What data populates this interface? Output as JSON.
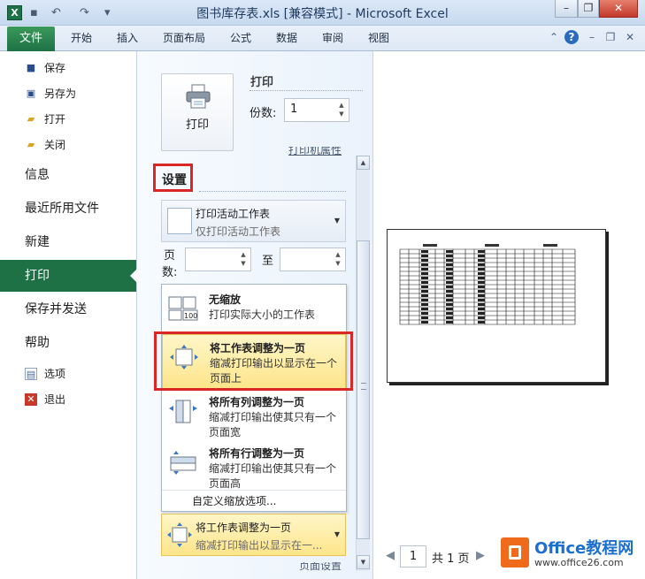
{
  "window": {
    "title": "图书库存表.xls  [兼容模式] - Microsoft Excel",
    "app_icon": "X"
  },
  "ribbon": {
    "file_tab": "文件",
    "tabs": [
      "开始",
      "插入",
      "页面布局",
      "公式",
      "数据",
      "审阅",
      "视图"
    ]
  },
  "nav": {
    "save": "保存",
    "save_as": "另存为",
    "open": "打开",
    "close": "关闭",
    "info": "信息",
    "recent": "最近所用文件",
    "new": "新建",
    "print": "打印",
    "save_send": "保存并发送",
    "help": "帮助",
    "options": "选项",
    "exit": "退出"
  },
  "print_panel": {
    "print_button": "打印",
    "header": "打印",
    "copies_label": "份数:",
    "copies_value": "1",
    "printer_properties": "打印机属性",
    "settings_header": "设置",
    "print_what": {
      "title": "打印活动工作表",
      "subtitle": "仅打印活动工作表"
    },
    "pages_label_1": "页",
    "pages_label_2": "数:",
    "to_label": "至",
    "scaling_menu": [
      {
        "title": "无缩放",
        "desc": "打印实际大小的工作表",
        "selected": false
      },
      {
        "title": "将工作表调整为一页",
        "desc": "缩减打印输出以显示在一个页面上",
        "selected": true
      },
      {
        "title": "将所有列调整为一页",
        "desc": "缩减打印输出使其只有一个页面宽",
        "selected": false
      },
      {
        "title": "将所有行调整为一页",
        "desc": "缩减打印输出使其只有一个页面高",
        "selected": false
      }
    ],
    "custom_scaling": "自定义缩放选项...",
    "scaling_current": {
      "title": "将工作表调整为一页",
      "subtitle": "缩减打印输出以显示在一..."
    },
    "page_setup": "页面设置"
  },
  "preview": {
    "current_page": "1",
    "total_pages": "共 1 页"
  },
  "watermark": {
    "title": "Office教程网",
    "url": "www.office26.com"
  },
  "colors": {
    "file_tab": "#1e7145",
    "highlight": "#fde58a",
    "annotation_red": "#d92626"
  }
}
